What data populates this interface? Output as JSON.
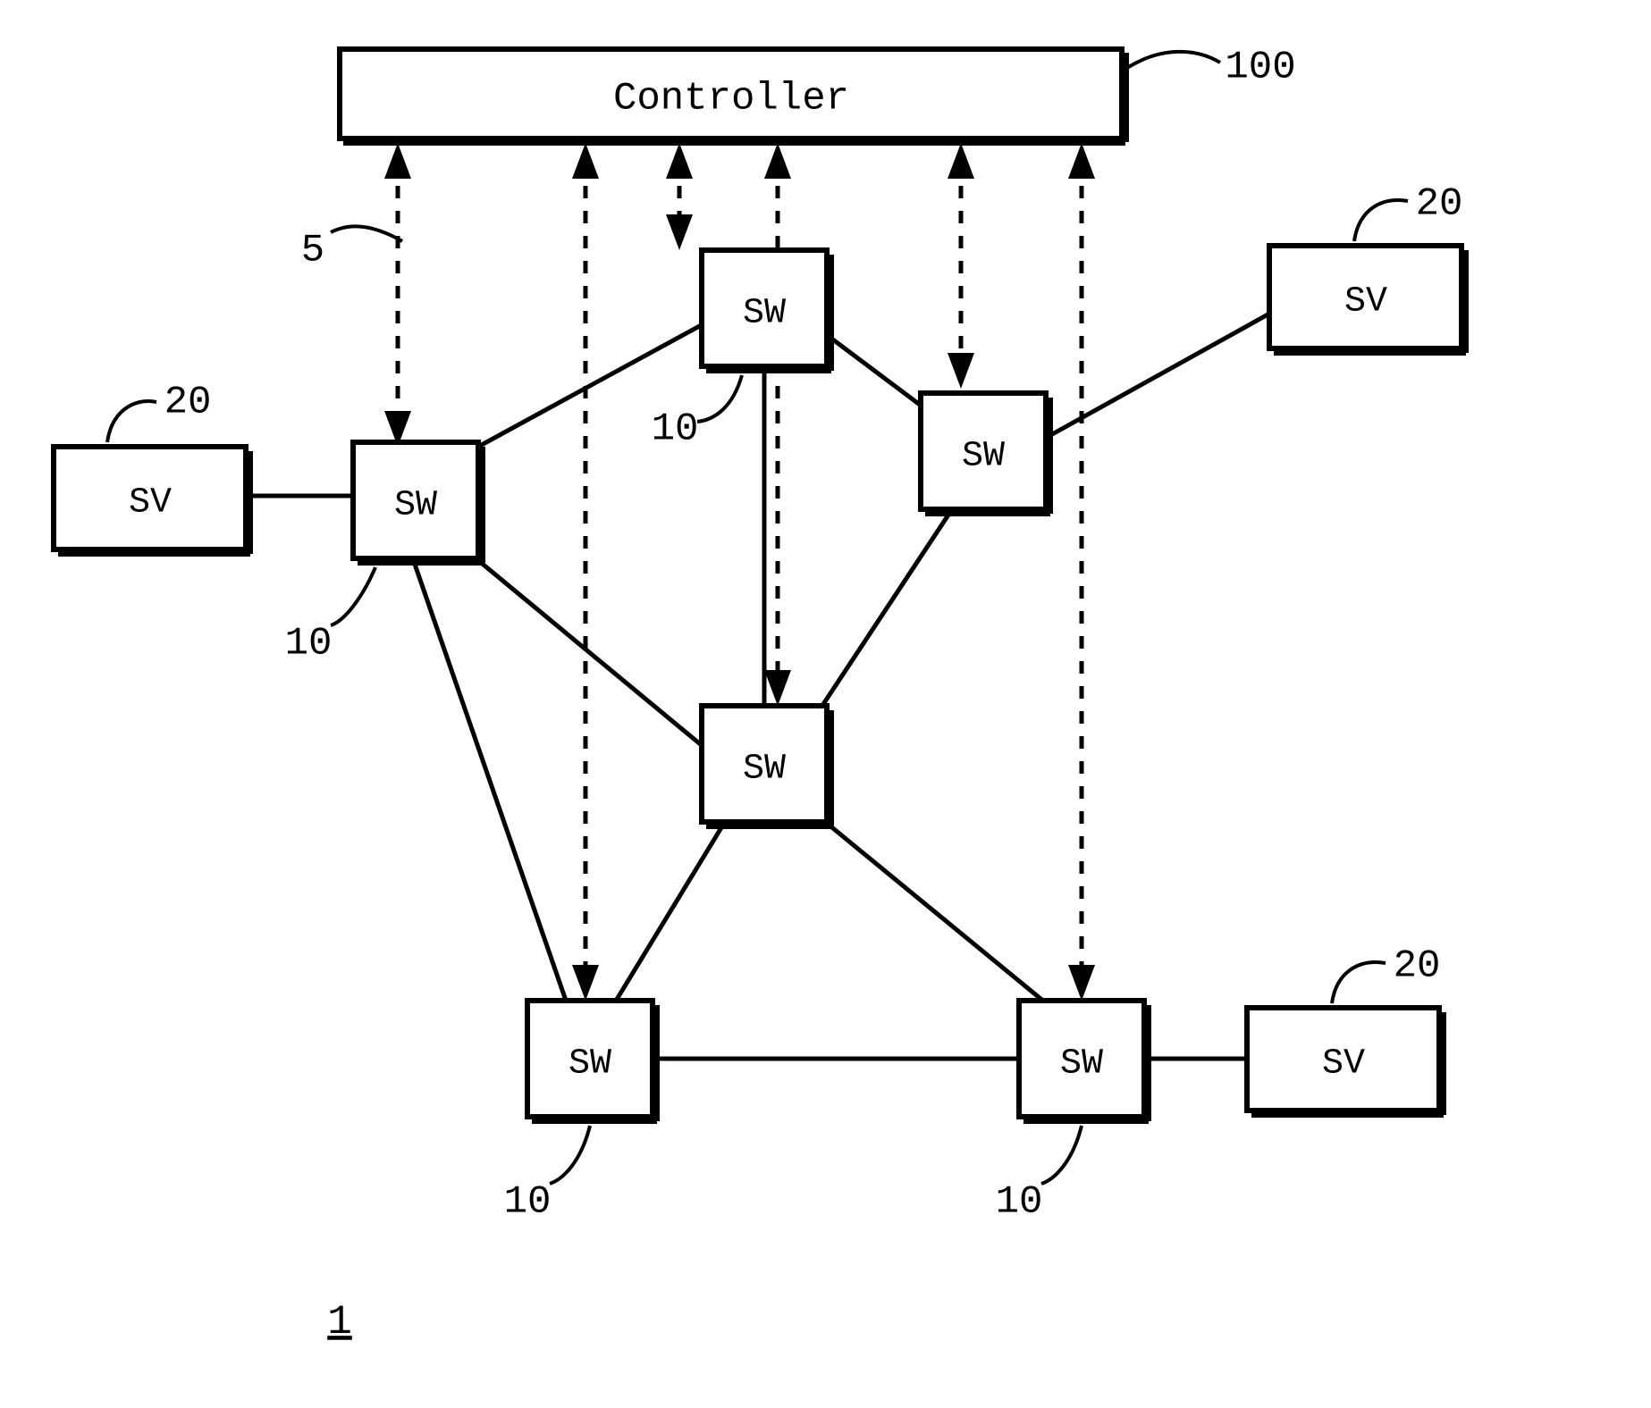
{
  "diagram": {
    "controller_label": "Controller",
    "sw_label": "SW",
    "sv_label": "SV",
    "ref_controller": "100",
    "ref_sw": "10",
    "ref_sv": "20",
    "ref_control_link": "5",
    "figure_number": "1"
  }
}
